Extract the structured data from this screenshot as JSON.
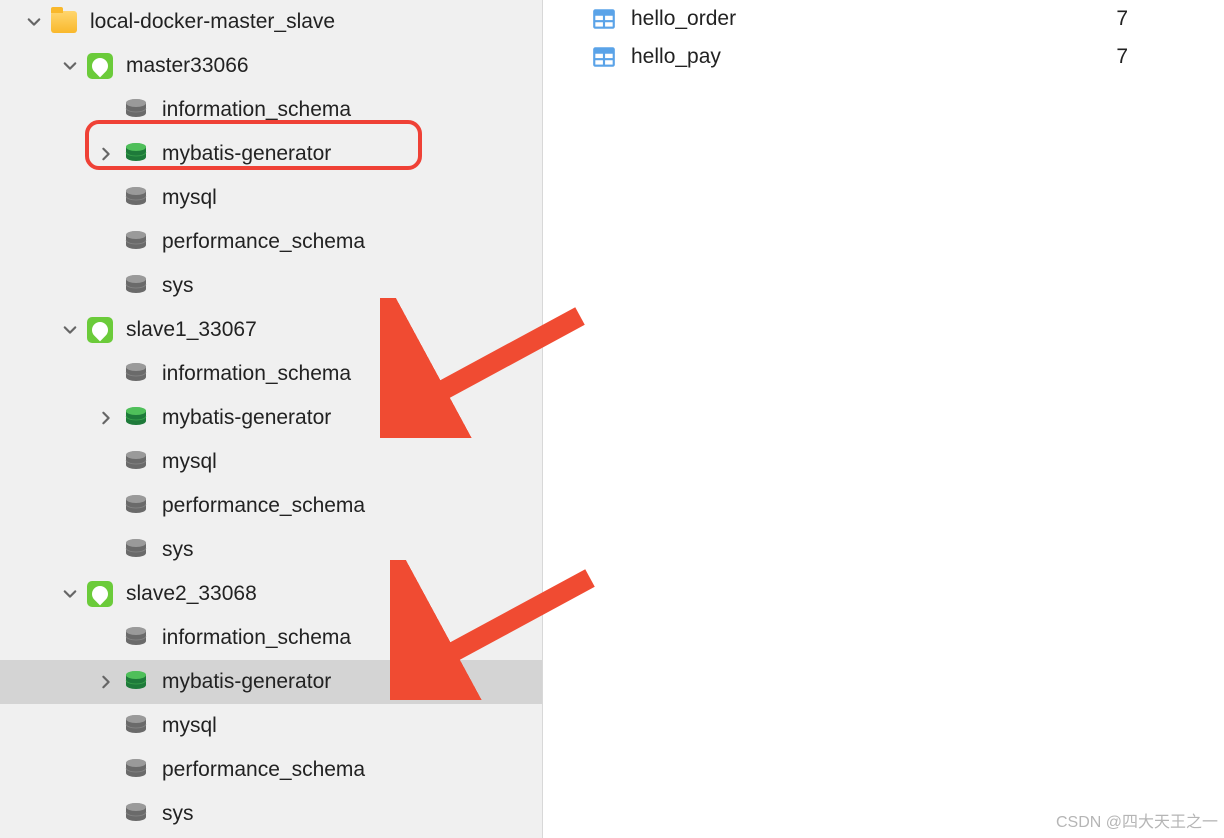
{
  "sidebar": {
    "root": {
      "label": "local-docker-master_slave"
    },
    "connections": [
      {
        "label": "master33066",
        "databases": [
          {
            "label": "information_schema",
            "active": false,
            "expandable": false
          },
          {
            "label": "mybatis-generator",
            "active": true,
            "expandable": true,
            "highlighted": true
          },
          {
            "label": "mysql",
            "active": false,
            "expandable": false
          },
          {
            "label": "performance_schema",
            "active": false,
            "expandable": false
          },
          {
            "label": "sys",
            "active": false,
            "expandable": false
          }
        ]
      },
      {
        "label": "slave1_33067",
        "databases": [
          {
            "label": "information_schema",
            "active": false,
            "expandable": false
          },
          {
            "label": "mybatis-generator",
            "active": true,
            "expandable": true,
            "arrow": true
          },
          {
            "label": "mysql",
            "active": false,
            "expandable": false
          },
          {
            "label": "performance_schema",
            "active": false,
            "expandable": false
          },
          {
            "label": "sys",
            "active": false,
            "expandable": false
          }
        ]
      },
      {
        "label": "slave2_33068",
        "databases": [
          {
            "label": "information_schema",
            "active": false,
            "expandable": false
          },
          {
            "label": "mybatis-generator",
            "active": true,
            "expandable": true,
            "arrow": true,
            "selected": true
          },
          {
            "label": "mysql",
            "active": false,
            "expandable": false
          },
          {
            "label": "performance_schema",
            "active": false,
            "expandable": false
          },
          {
            "label": "sys",
            "active": false,
            "expandable": false
          }
        ]
      }
    ]
  },
  "main": {
    "tables": [
      {
        "name": "hello_order",
        "count": "7"
      },
      {
        "name": "hello_pay",
        "count": "7"
      }
    ]
  },
  "watermark": "CSDN @四大天王之一"
}
